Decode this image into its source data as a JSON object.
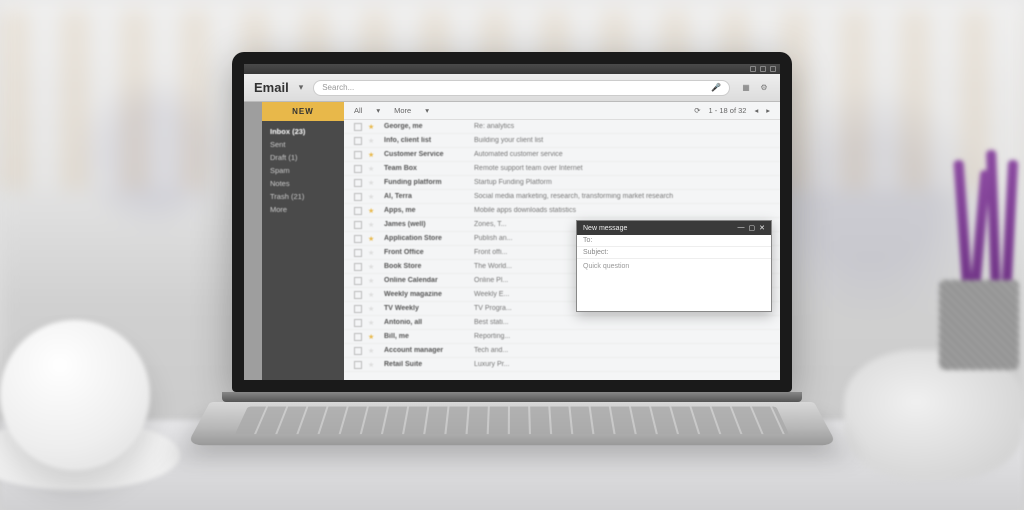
{
  "app": {
    "title": "Email"
  },
  "search": {
    "placeholder": "Search..."
  },
  "toolbar": {
    "new_label": "NEW"
  },
  "sidebar": {
    "items": [
      {
        "label": "Inbox (23)"
      },
      {
        "label": "Sent"
      },
      {
        "label": "Draft (1)"
      },
      {
        "label": "Spam"
      },
      {
        "label": "Notes"
      },
      {
        "label": "Trash (21)"
      },
      {
        "label": "More"
      }
    ]
  },
  "list_header": {
    "all": "All",
    "more": "More",
    "page": "1 - 18 of 32"
  },
  "emails": [
    {
      "starred": true,
      "sender": "George, me",
      "subject": "Re: analytics"
    },
    {
      "starred": false,
      "sender": "Info, client list",
      "subject": "Building your client list"
    },
    {
      "starred": true,
      "sender": "Customer Service",
      "subject": "Automated customer service"
    },
    {
      "starred": false,
      "sender": "Team Box",
      "subject": "Remote support team over Internet"
    },
    {
      "starred": false,
      "sender": "Funding platform",
      "subject": "Startup Funding Platform"
    },
    {
      "starred": false,
      "sender": "Al, Terra",
      "subject": "Social media marketing, research, transforming market research"
    },
    {
      "starred": true,
      "sender": "Apps, me",
      "subject": "Mobile apps downloads statistics"
    },
    {
      "starred": false,
      "sender": "James (well)",
      "subject": "Zones, T..."
    },
    {
      "starred": true,
      "sender": "Application Store",
      "subject": "Publish an..."
    },
    {
      "starred": false,
      "sender": "Front Office",
      "subject": "Front offi..."
    },
    {
      "starred": false,
      "sender": "Book Store",
      "subject": "The World..."
    },
    {
      "starred": false,
      "sender": "Online Calendar",
      "subject": "Online Pl..."
    },
    {
      "starred": false,
      "sender": "Weekly magazine",
      "subject": "Weekly E..."
    },
    {
      "starred": false,
      "sender": "TV Weekly",
      "subject": "TV Progra..."
    },
    {
      "starred": false,
      "sender": "Antonio, all",
      "subject": "Best stati..."
    },
    {
      "starred": true,
      "sender": "Bill, me",
      "subject": "Reporting..."
    },
    {
      "starred": false,
      "sender": "Account manager",
      "subject": "Tech and..."
    },
    {
      "starred": false,
      "sender": "Retail Suite",
      "subject": "Luxury Pr..."
    }
  ],
  "compose": {
    "title": "New message",
    "to_label": "To:",
    "subject_label": "Subject:",
    "body": "Quick question"
  }
}
